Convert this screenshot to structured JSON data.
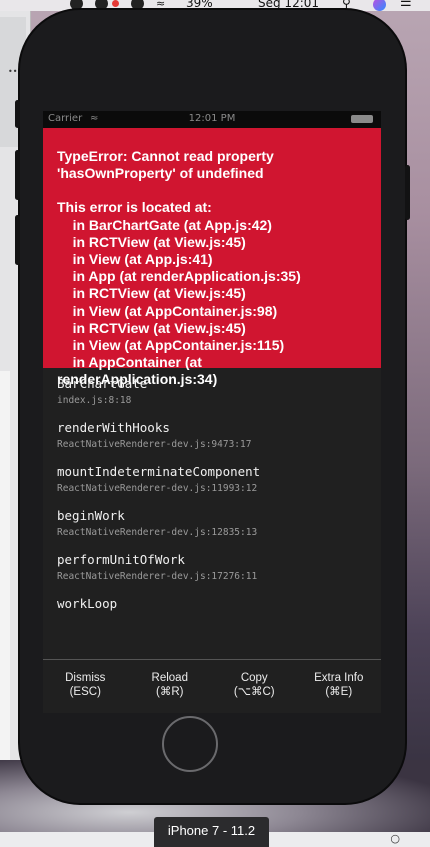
{
  "menubar": {
    "battery": "39%",
    "clock": "Seg 12:01",
    "icons": [
      "skype-icon",
      "creative-cloud-icon",
      "upload-icon",
      "wifi-icon",
      "battery-icon",
      "search-icon",
      "siri-icon",
      "list-icon"
    ]
  },
  "status_bar": {
    "carrier": "Carrier",
    "time": "12:01 PM"
  },
  "error": {
    "message": "TypeError: Cannot read property\n'hasOwnProperty' of undefined",
    "location_header": "This error is located at:",
    "location_lines": [
      "    in BarChartGate (at App.js:42)",
      "    in RCTView (at View.js:45)",
      "    in View (at App.js:41)",
      "    in App (at renderApplication.js:35)",
      "    in RCTView (at View.js:45)",
      "    in View (at AppContainer.js:98)",
      "    in RCTView (at View.js:45)",
      "    in View (at AppContainer.js:115)",
      "    in AppContainer (at",
      "renderApplication.js:34)"
    ]
  },
  "stack": [
    {
      "fn": "BarChartGate",
      "file": "index.js:8:18"
    },
    {
      "fn": "renderWithHooks",
      "file": "ReactNativeRenderer-dev.js:9473:17"
    },
    {
      "fn": "mountIndeterminateComponent",
      "file": "ReactNativeRenderer-dev.js:11993:12"
    },
    {
      "fn": "beginWork",
      "file": "ReactNativeRenderer-dev.js:12835:13"
    },
    {
      "fn": "performUnitOfWork",
      "file": "ReactNativeRenderer-dev.js:17276:11"
    },
    {
      "fn": "workLoop",
      "file": ""
    }
  ],
  "toolbar": {
    "dismiss": "Dismiss\n(ESC)",
    "reload": "Reload\n(⌘R)",
    "copy": "Copy\n(⌥⌘C)",
    "extra": "Extra Info\n(⌘E)"
  },
  "device_label": "iPhone 7 - 11.2",
  "colors": {
    "error_red": "#d01530",
    "screen_bg": "#202020"
  }
}
